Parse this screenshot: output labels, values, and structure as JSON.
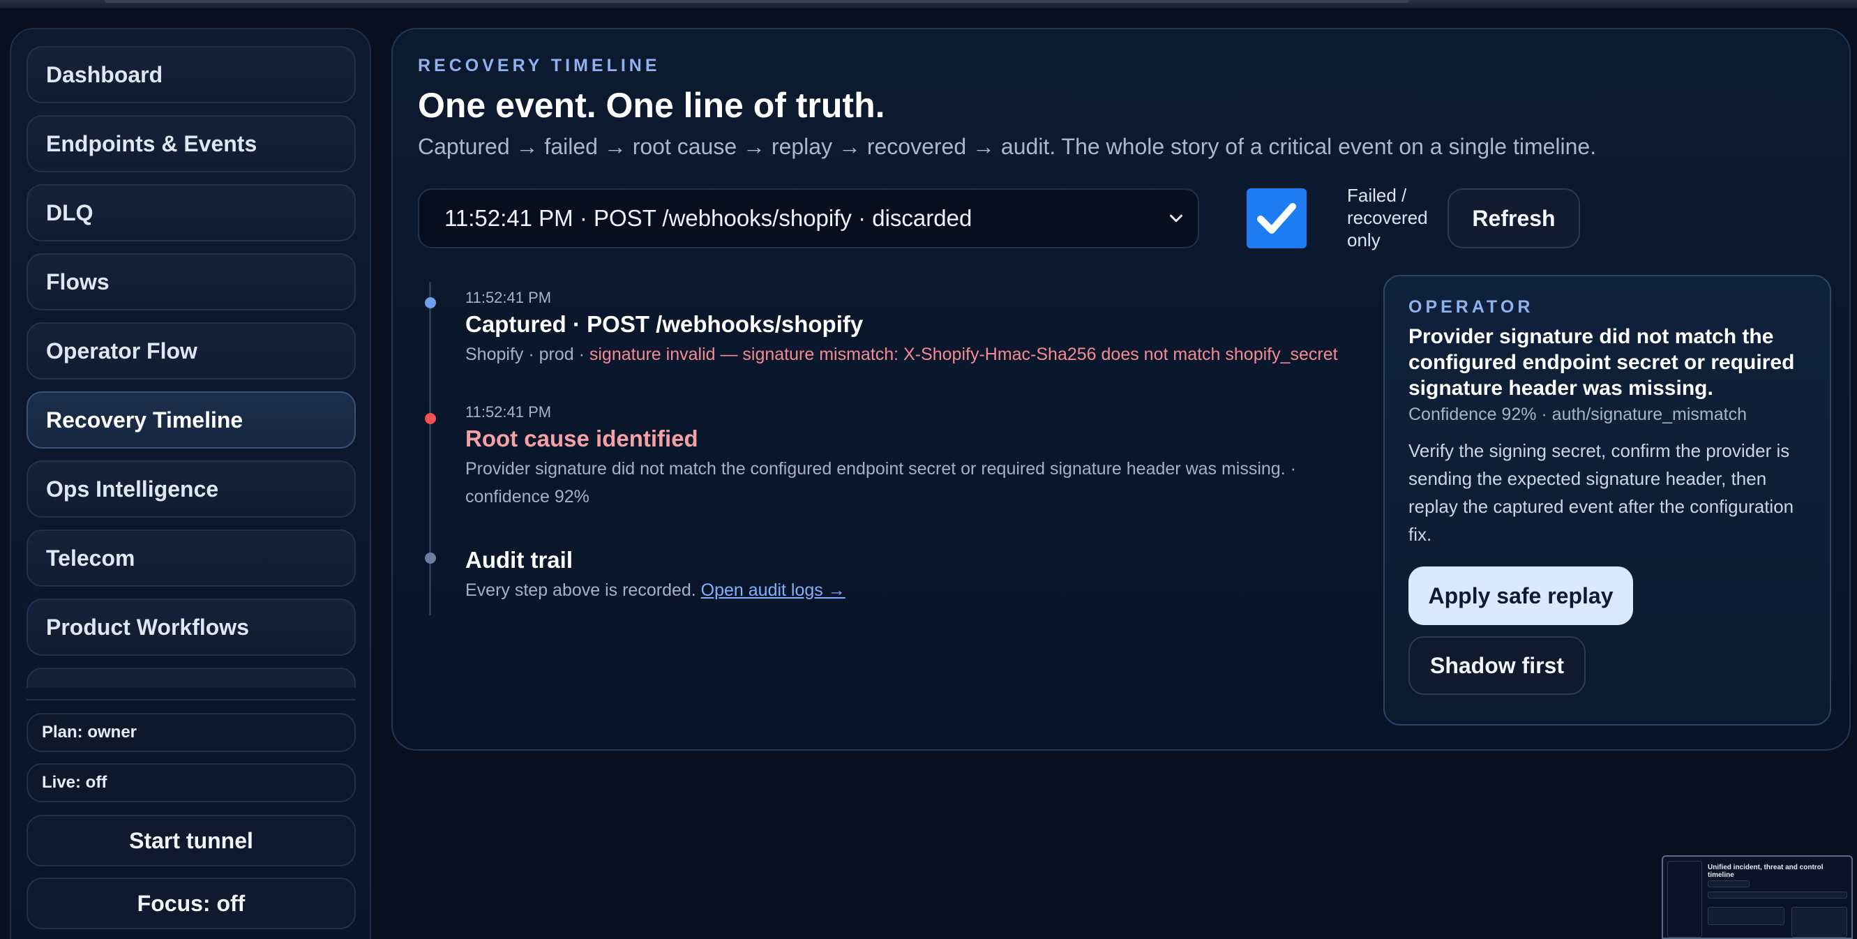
{
  "sidebar": {
    "items": [
      {
        "label": "Dashboard",
        "active": false
      },
      {
        "label": "Endpoints & Events",
        "active": false
      },
      {
        "label": "DLQ",
        "active": false
      },
      {
        "label": "Flows",
        "active": false
      },
      {
        "label": "Operator Flow",
        "active": false
      },
      {
        "label": "Recovery Timeline",
        "active": true
      },
      {
        "label": "Ops Intelligence",
        "active": false
      },
      {
        "label": "Telecom",
        "active": false
      },
      {
        "label": "Product Workflows",
        "active": false
      }
    ],
    "plan": "Plan: owner",
    "live": "Live: off",
    "start_tunnel": "Start tunnel",
    "focus": "Focus: off"
  },
  "main": {
    "eyebrow": "RECOVERY TIMELINE",
    "title": "One event. One line of truth.",
    "subtitle": "Captured → failed → root cause → replay → recovered → audit. The whole story of a critical event on a single timeline.",
    "event_select": "11:52:41 PM · POST /webhooks/shopify · discarded",
    "filter_checked": true,
    "filter_label": "Failed / recovered only",
    "refresh_label": "Refresh"
  },
  "timeline": [
    {
      "time": "11:52:41 PM",
      "title": "Captured · POST /webhooks/shopify",
      "desc_prefix": "Shopify · prod · ",
      "desc_error": "signature invalid — signature mismatch: X-Shopify-Hmac-Sha256 does not match shopify_secret",
      "dot_color": "#6f9ef0"
    },
    {
      "time": "11:52:41 PM",
      "title": "Root cause identified",
      "desc": "Provider signature did not match the configured endpoint secret or required signature header was missing. · confidence 92%",
      "dot_color": "#ef5350",
      "title_color": "#f7a0a6"
    },
    {
      "title": "Audit trail",
      "desc_prefix": "Every step above is recorded. ",
      "link": "Open audit logs →",
      "dot_color": "#6c7fa3"
    }
  ],
  "operator": {
    "eyebrow": "OPERATOR",
    "title": "Provider signature did not match the configured endpoint secret or required signature header was missing.",
    "meta": "Confidence 92% · auth/signature_mismatch",
    "body": "Verify the signing secret, confirm the provider is sending the expected signature header, then replay the captured event after the configuration fix.",
    "apply_label": "Apply safe replay",
    "shadow_label": "Shadow first"
  },
  "minimap": {
    "title": "Unified incident, threat and control timeline"
  },
  "colors": {
    "accent": "#1e7cf2",
    "eyebrow": "#8fb3ee",
    "error": "#f58a92",
    "link": "#7fb1ff"
  }
}
